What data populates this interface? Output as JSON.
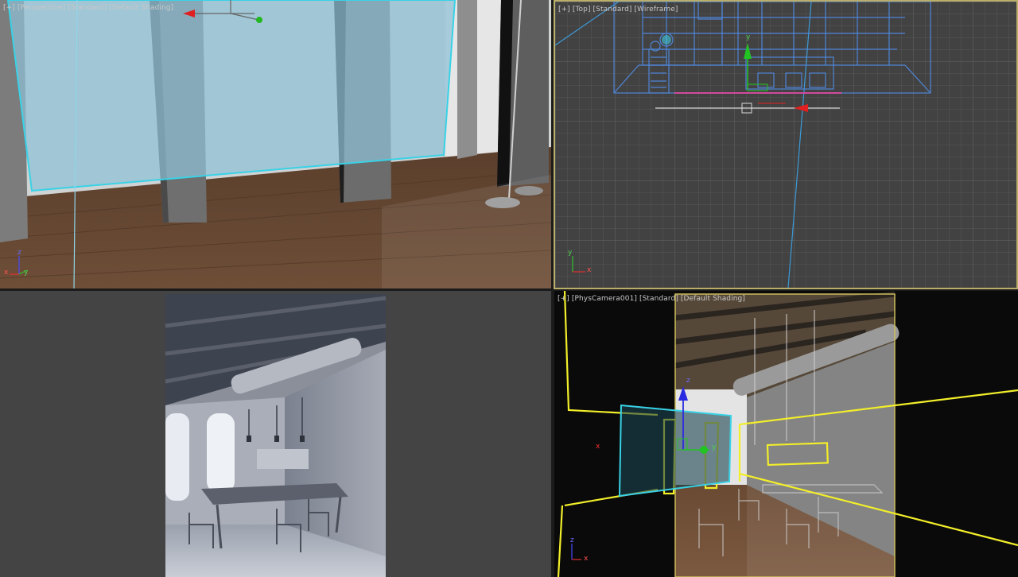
{
  "viewports": {
    "perspective": {
      "labels": [
        "[+]",
        "[Perspective]",
        "[Standard]",
        "[Default Shading]"
      ]
    },
    "top": {
      "labels": [
        "[+]",
        "[Top]",
        "[Standard]",
        "[Wireframe]"
      ]
    },
    "render": {},
    "camera": {
      "labels": [
        "[+]",
        "[PhysCamera001]",
        "[Standard]",
        "[Default Shading]"
      ]
    }
  },
  "gizmo_axes": {
    "x": "x",
    "y": "y",
    "z": "z"
  },
  "colors": {
    "viewport_bg": "#444444",
    "grid": "#575757",
    "selection": "#39d2e6",
    "wireframe": "#4f86d9",
    "camera_cone": "#f2ee2a",
    "active_border": "#b9ae6a"
  }
}
